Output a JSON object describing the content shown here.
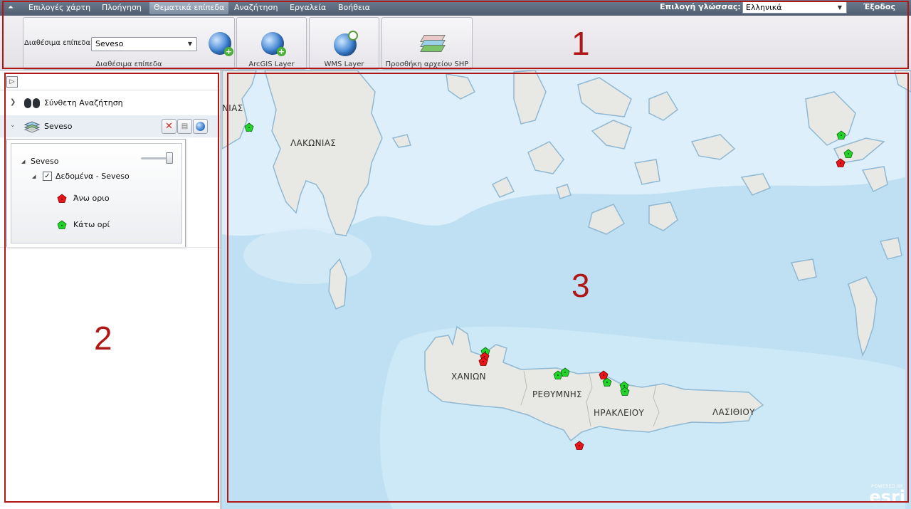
{
  "menubar": {
    "items": [
      "Επιλογές χάρτη",
      "Πλοήγηση",
      "Θεματικά επίπεδα",
      "Αναζήτηση",
      "Εργαλεία",
      "Βοήθεια"
    ],
    "active_item": "Θεματικά επίπεδα",
    "language_label": "Επιλογή γλώσσας:",
    "language_value": "Ελληνικά",
    "exit_label": "Έξοδος"
  },
  "ribbon": {
    "available_layers_label": "Διαθέσιμα επίπεδα",
    "available_layers_value": "Seveso",
    "available_layers_caption": "Διαθέσιμα επίπεδα",
    "arcgis_caption": "ArcGIS Layer",
    "wms_caption": "WMS Layer",
    "shp_caption": "Προσθήκη αρχείου SHP"
  },
  "left_panel": {
    "toggle_icon": "triangle-right-icon",
    "search_row_label": "Σύνθετη Αναζήτηση",
    "seveso_row_label": "Seveso",
    "legend": {
      "layer_name": "Seveso",
      "opacity": 1.0,
      "group_name": "Δεδομένα - Seveso",
      "group_checked": true,
      "items": [
        {
          "label": "Άνω οριο",
          "color": "#e8141a"
        },
        {
          "label": "Κάτω ορί",
          "color": "#22d42a"
        }
      ]
    }
  },
  "map": {
    "sea_color": "#bfe0f3",
    "land_color": "#e8e9e4",
    "place_labels": [
      "ΝΙΑΣ",
      "ΛΑΚΩΝΙΑΣ",
      "ΧΑΝΙΩΝ",
      "ΡΕΘΥΜΝΗΣ",
      "ΗΡΑΚΛΕΙΟΥ",
      "ΛΑΣΙΘΙΟΥ"
    ],
    "logo_powered": "POWERED BY",
    "logo_name": "esri"
  },
  "annotations": [
    "1",
    "2",
    "3"
  ]
}
